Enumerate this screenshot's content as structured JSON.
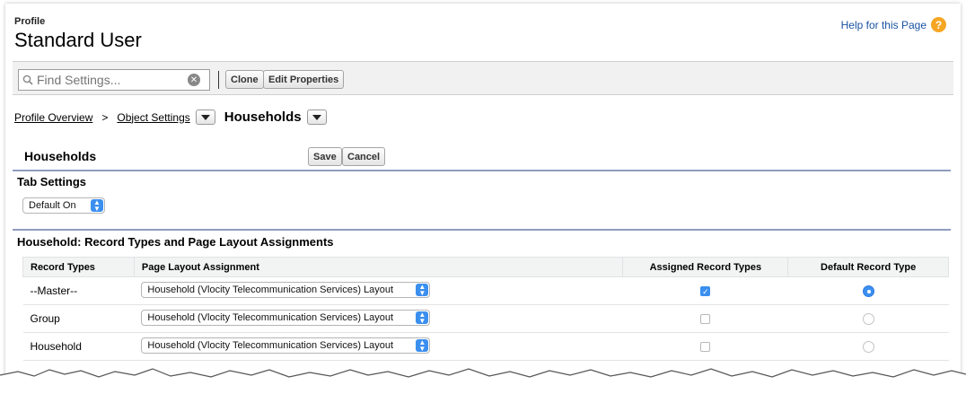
{
  "header": {
    "kicker": "Profile",
    "title": "Standard User",
    "help_label": "Help for this Page",
    "help_icon": "?"
  },
  "toolbar": {
    "search_placeholder": "Find Settings...",
    "clone_label": "Clone",
    "edit_properties_label": "Edit Properties"
  },
  "breadcrumb": {
    "overview": "Profile Overview",
    "separator": ">",
    "object_settings": "Object Settings",
    "current": "Households"
  },
  "section": {
    "title": "Households",
    "save_label": "Save",
    "cancel_label": "Cancel"
  },
  "tab_settings": {
    "heading": "Tab Settings",
    "value": "Default On"
  },
  "record_types": {
    "heading": "Household: Record Types and Page Layout Assignments",
    "columns": [
      "Record Types",
      "Page Layout Assignment",
      "Assigned Record Types",
      "Default Record Type"
    ],
    "rows": [
      {
        "name": "--Master--",
        "layout": "Household (Vlocity Telecommunication Services) Layout",
        "assigned": true,
        "default": true
      },
      {
        "name": "Group",
        "layout": "Household (Vlocity Telecommunication Services) Layout",
        "assigned": false,
        "default": false
      },
      {
        "name": "Household",
        "layout": "Household (Vlocity Telecommunication Services) Layout",
        "assigned": false,
        "default": false
      }
    ]
  },
  "colors": {
    "accent": "#3b8fef",
    "rule": "#8e9dbe",
    "help_link": "#1a53a0",
    "help_badge": "#f5a623"
  }
}
